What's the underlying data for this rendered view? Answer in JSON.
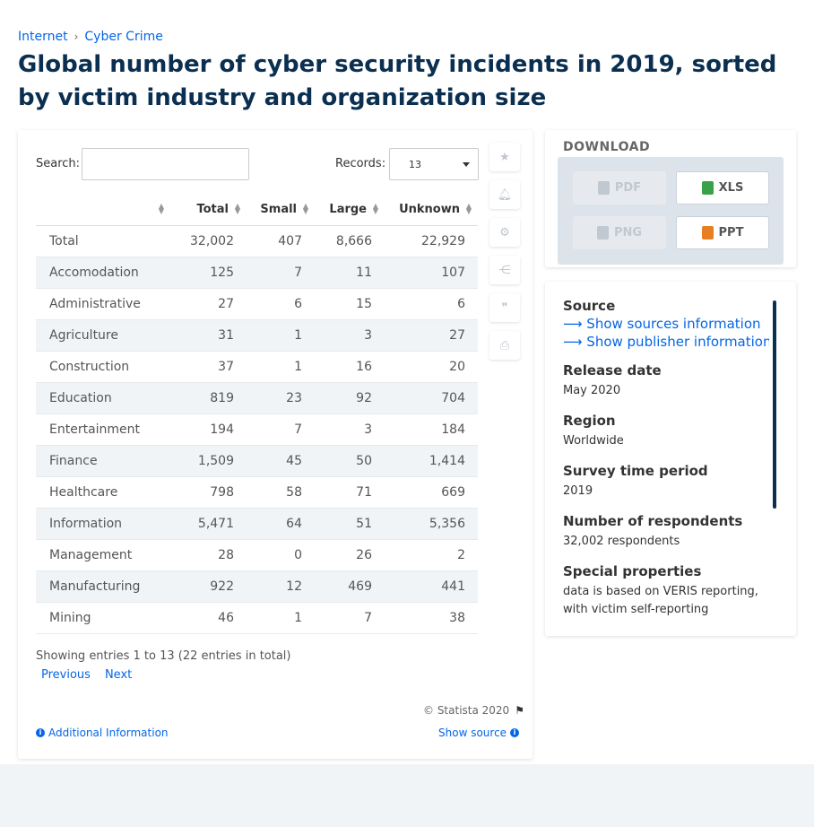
{
  "breadcrumb": {
    "items": [
      "Internet",
      "Cyber Crime"
    ],
    "separator": "›"
  },
  "title": "Global number of cyber security incidents in 2019, sorted by victim industry and organization size",
  "table": {
    "search_label": "Search:",
    "search_value": "",
    "records_label": "Records:",
    "records_value": "13",
    "columns": [
      "",
      "Total",
      "Small",
      "Large",
      "Unknown"
    ],
    "rows": [
      [
        "Total",
        "32,002",
        "407",
        "8,666",
        "22,929"
      ],
      [
        "Accomodation",
        "125",
        "7",
        "11",
        "107"
      ],
      [
        "Administrative",
        "27",
        "6",
        "15",
        "6"
      ],
      [
        "Agriculture",
        "31",
        "1",
        "3",
        "27"
      ],
      [
        "Construction",
        "37",
        "1",
        "16",
        "20"
      ],
      [
        "Education",
        "819",
        "23",
        "92",
        "704"
      ],
      [
        "Entertainment",
        "194",
        "7",
        "3",
        "184"
      ],
      [
        "Finance",
        "1,509",
        "45",
        "50",
        "1,414"
      ],
      [
        "Healthcare",
        "798",
        "58",
        "71",
        "669"
      ],
      [
        "Information",
        "5,471",
        "64",
        "51",
        "5,356"
      ],
      [
        "Management",
        "28",
        "0",
        "26",
        "2"
      ],
      [
        "Manufacturing",
        "922",
        "12",
        "469",
        "441"
      ],
      [
        "Mining",
        "46",
        "1",
        "7",
        "38"
      ]
    ],
    "showing": "Showing entries 1 to 13 (22 entries in total)",
    "prev_label": "Previous",
    "next_label": "Next"
  },
  "footer": {
    "copyright": "© Statista 2020",
    "additional_info": "Additional Information",
    "show_source": "Show source"
  },
  "tools": [
    "star-icon",
    "bell-icon",
    "gear-icon",
    "share-icon",
    "quote-icon",
    "print-icon"
  ],
  "download": {
    "title": "DOWNLOAD",
    "pdf": "PDF",
    "xls": "XLS",
    "png": "PNG",
    "ppt": "PPT"
  },
  "info": {
    "source_heading": "Source",
    "show_sources": "Show sources information",
    "show_publisher": "Show publisher information",
    "release_heading": "Release date",
    "release_value": "May 2020",
    "region_heading": "Region",
    "region_value": "Worldwide",
    "period_heading": "Survey time period",
    "period_value": "2019",
    "respondents_heading": "Number of respondents",
    "respondents_value": "32,002 respondents",
    "special_heading": "Special properties",
    "special_value": "data is based on VERIS reporting, with victim self-reporting"
  },
  "colors": {
    "title": "#0b2f50",
    "link": "#0666e5",
    "stripe": "#f1f4f7"
  }
}
